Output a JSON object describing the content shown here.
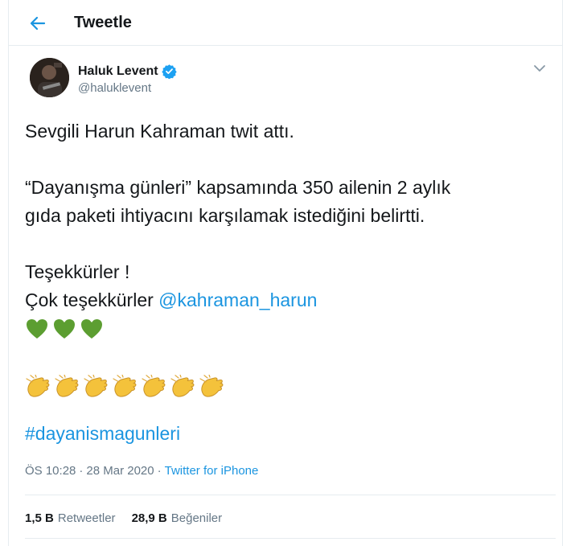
{
  "header": {
    "title": "Tweetle"
  },
  "author": {
    "name": "Haluk Levent",
    "handle": "@haluklevent",
    "verified": true
  },
  "tweet": {
    "line1": "Sevgili Harun Kahraman twit attı.",
    "line2": "“Dayanışma günleri” kapsamında 350 ailenin 2 aylık",
    "line3": "gıda paketi ihtiyacını karşılamak istediğini belirtti.",
    "line4": "Teşekkürler !",
    "line5_prefix": "Çok teşekkürler",
    "mention": "@kahraman_harun",
    "hearts": "💚💚💚",
    "clap_count": 7,
    "hashtag": "#dayanismagunleri"
  },
  "meta": {
    "time": "ÖS 10:28",
    "sep1": "·",
    "date": "28 Mar 2020",
    "sep2": "·",
    "source": "Twitter for iPhone"
  },
  "stats": {
    "retweets_count": "1,5 B",
    "retweets_label": "Retweetler",
    "likes_count": "28,9 B",
    "likes_label": "Beğeniler"
  },
  "colors": {
    "accent": "#1b95e0",
    "text": "#14171a",
    "muted": "#657786",
    "heart": "#5c9e31",
    "clap": "#f4c23b"
  },
  "icons": {
    "back": "back-arrow-icon",
    "verified": "verified-badge-icon",
    "caret": "chevron-down-icon"
  }
}
